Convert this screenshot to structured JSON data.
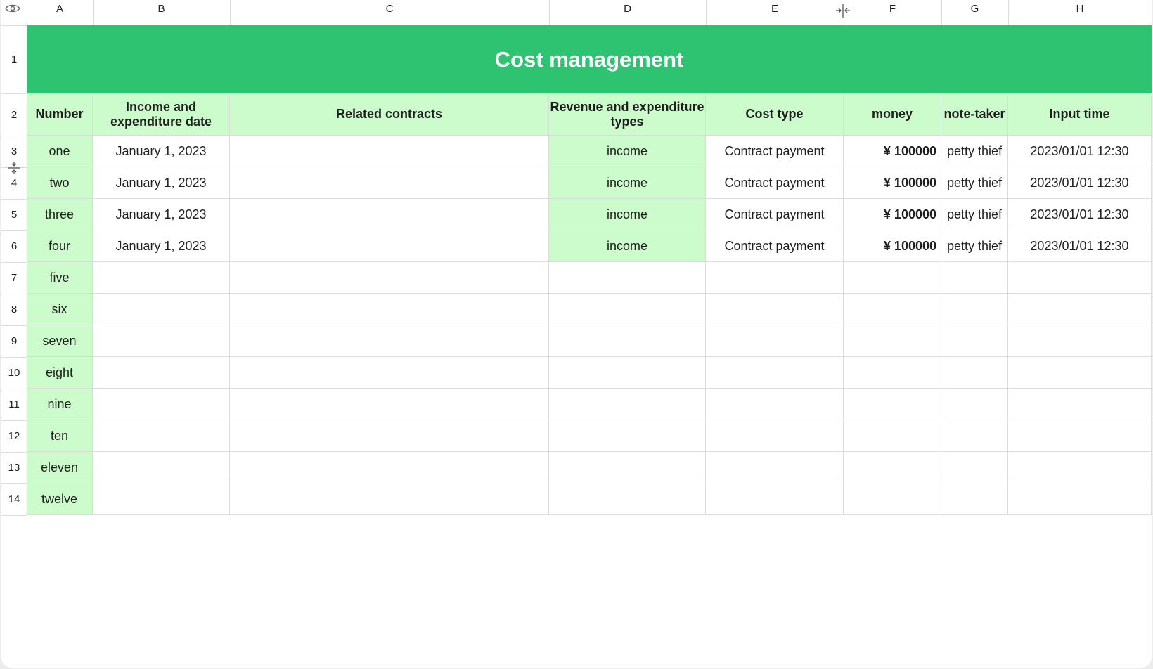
{
  "columns": [
    "A",
    "B",
    "C",
    "D",
    "E",
    "F",
    "G",
    "H"
  ],
  "rows": [
    "1",
    "2",
    "3",
    "4",
    "5",
    "6",
    "7",
    "8",
    "9",
    "10",
    "11",
    "12",
    "13",
    "14"
  ],
  "title": "Cost management",
  "headers": [
    "Number",
    "Income and expenditure date",
    "Related contracts",
    "Revenue and expenditure types",
    "Cost type",
    "money",
    "note-taker",
    "Input time"
  ],
  "data_rows": [
    [
      "one",
      "January 1, 2023",
      "",
      "income",
      "Contract payment",
      "¥ 100000",
      "petty thief",
      "2023/01/01 12:30"
    ],
    [
      "two",
      "January 1, 2023",
      "",
      "income",
      "Contract payment",
      "¥ 100000",
      "petty thief",
      "2023/01/01 12:30"
    ],
    [
      "three",
      "January 1, 2023",
      "",
      "income",
      "Contract payment",
      "¥ 100000",
      "petty thief",
      "2023/01/01 12:30"
    ],
    [
      "four",
      "January 1, 2023",
      "",
      "income",
      "Contract payment",
      "¥ 100000",
      "petty thief",
      "2023/01/01 12:30"
    ],
    [
      "five",
      "",
      "",
      "",
      "",
      "",
      "",
      ""
    ],
    [
      "six",
      "",
      "",
      "",
      "",
      "",
      "",
      ""
    ],
    [
      "seven",
      "",
      "",
      "",
      "",
      "",
      "",
      ""
    ],
    [
      "eight",
      "",
      "",
      "",
      "",
      "",
      "",
      ""
    ],
    [
      "nine",
      "",
      "",
      "",
      "",
      "",
      "",
      ""
    ],
    [
      "ten",
      "",
      "",
      "",
      "",
      "",
      "",
      ""
    ],
    [
      "eleven",
      "",
      "",
      "",
      "",
      "",
      "",
      ""
    ],
    [
      "twelve",
      "",
      "",
      "",
      "",
      "",
      "",
      ""
    ]
  ],
  "colors": {
    "title_bg": "#2ec371",
    "title_text": "#ffffff",
    "header_bg": "#ccfccc",
    "grid_line": "#dcdcdc"
  },
  "icons": {
    "top_left": "eye-icon",
    "column_resize": "column-resize-icon",
    "row_resize": "row-resize-icon"
  }
}
